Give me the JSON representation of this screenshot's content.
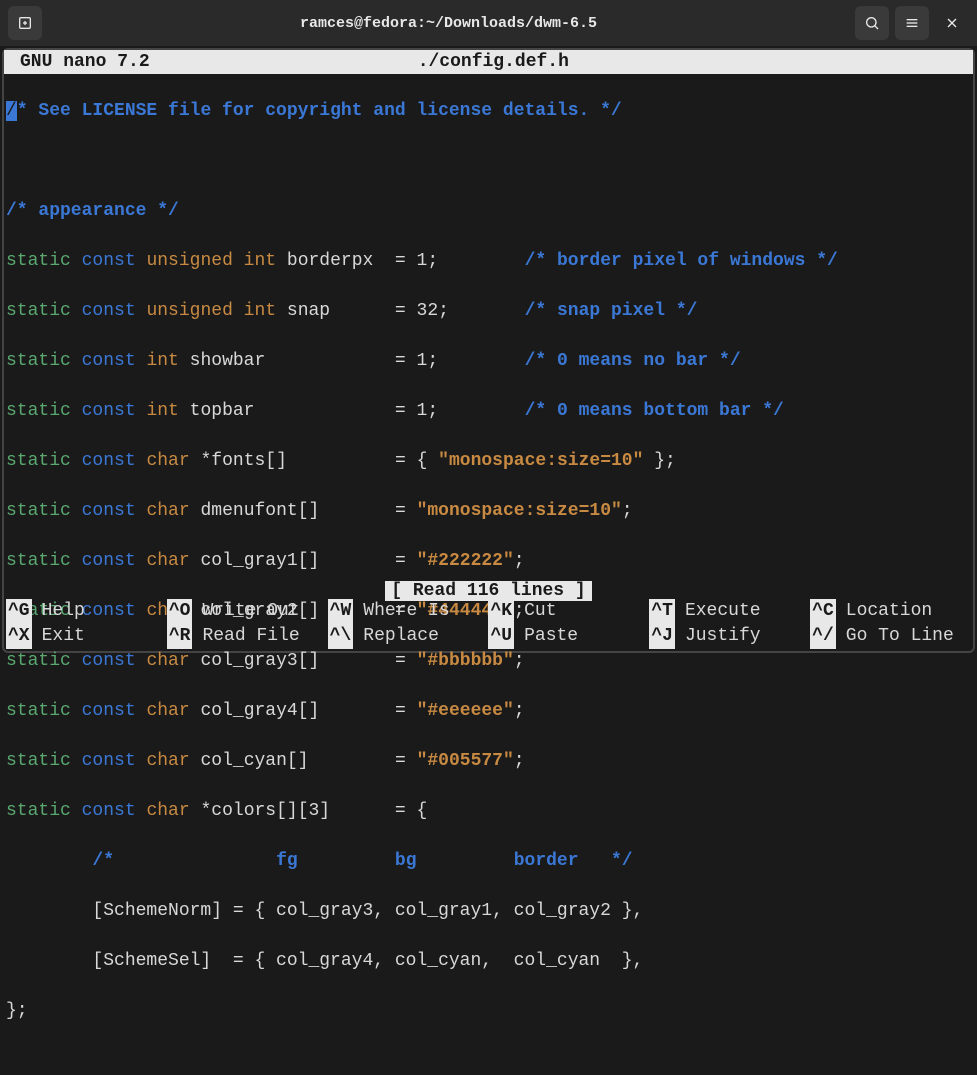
{
  "titlebar": {
    "title": "ramces@fedora:~/Downloads/dwm-6.5"
  },
  "nano": {
    "app": "GNU nano 7.2",
    "filename": "./config.def.h",
    "status": "[ Read 116 lines ]"
  },
  "code": {
    "l1_comment": "* See LICENSE file for copyright and license details. */",
    "l3_comment": "/* appearance */",
    "l4": {
      "kw1": "static",
      "kw2": "const",
      "type": "unsigned int",
      "name": "borderpx",
      "eq": "=",
      "val": "1",
      "semi": ";",
      "cmt": "/* border pixel of windows */"
    },
    "l5": {
      "kw1": "static",
      "kw2": "const",
      "type": "unsigned int",
      "name": "snap",
      "eq": "=",
      "val": "32",
      "semi": ";",
      "cmt": "/* snap pixel */"
    },
    "l6": {
      "kw1": "static",
      "kw2": "const",
      "type": "int",
      "name": "showbar",
      "eq": "=",
      "val": "1",
      "semi": ";",
      "cmt": "/* 0 means no bar */"
    },
    "l7": {
      "kw1": "static",
      "kw2": "const",
      "type": "int",
      "name": "topbar",
      "eq": "=",
      "val": "1",
      "semi": ";",
      "cmt": "/* 0 means bottom bar */"
    },
    "l8": {
      "kw1": "static",
      "kw2": "const",
      "type": "char",
      "name": "*fonts[]",
      "eq": "=",
      "open": "{ ",
      "val": "\"monospace:size=10\"",
      "close": " };"
    },
    "l9": {
      "kw1": "static",
      "kw2": "const",
      "type": "char",
      "name": "dmenufont[]",
      "eq": "=",
      "val": "\"monospace:size=10\"",
      "semi": ";"
    },
    "l10": {
      "kw1": "static",
      "kw2": "const",
      "type": "char",
      "name": "col_gray1[]",
      "eq": "=",
      "val": "\"#222222\"",
      "semi": ";"
    },
    "l11": {
      "kw1": "static",
      "kw2": "const",
      "type": "char",
      "name": "col_gray2[]",
      "eq": "=",
      "val": "\"#444444\"",
      "semi": ";"
    },
    "l12": {
      "kw1": "static",
      "kw2": "const",
      "type": "char",
      "name": "col_gray3[]",
      "eq": "=",
      "val": "\"#bbbbbb\"",
      "semi": ";"
    },
    "l13": {
      "kw1": "static",
      "kw2": "const",
      "type": "char",
      "name": "col_gray4[]",
      "eq": "=",
      "val": "\"#eeeeee\"",
      "semi": ";"
    },
    "l14": {
      "kw1": "static",
      "kw2": "const",
      "type": "char",
      "name": "col_cyan[]",
      "eq": "=",
      "val": "\"#005577\"",
      "semi": ";"
    },
    "l15": {
      "kw1": "static",
      "kw2": "const",
      "type": "char",
      "name": "*colors[][3]",
      "eq": "=",
      "open": "{"
    },
    "l16": {
      "cmt_open": "/*",
      "fg": "fg",
      "bg": "bg",
      "border": "border",
      "cmt_close": "*/"
    },
    "l17": "        [SchemeNorm] = { col_gray3, col_gray1, col_gray2 },",
    "l18": "        [SchemeSel]  = { col_gray4, col_cyan,  col_cyan  },",
    "l19": "};"
  },
  "shortcuts": [
    {
      "key": "^G",
      "label": "Help"
    },
    {
      "key": "^O",
      "label": "Write Out"
    },
    {
      "key": "^W",
      "label": "Where Is"
    },
    {
      "key": "^K",
      "label": "Cut"
    },
    {
      "key": "^T",
      "label": "Execute"
    },
    {
      "key": "^C",
      "label": "Location"
    },
    {
      "key": "^X",
      "label": "Exit"
    },
    {
      "key": "^R",
      "label": "Read File"
    },
    {
      "key": "^\\",
      "label": "Replace"
    },
    {
      "key": "^U",
      "label": "Paste"
    },
    {
      "key": "^J",
      "label": "Justify"
    },
    {
      "key": "^/",
      "label": "Go To Line"
    }
  ]
}
